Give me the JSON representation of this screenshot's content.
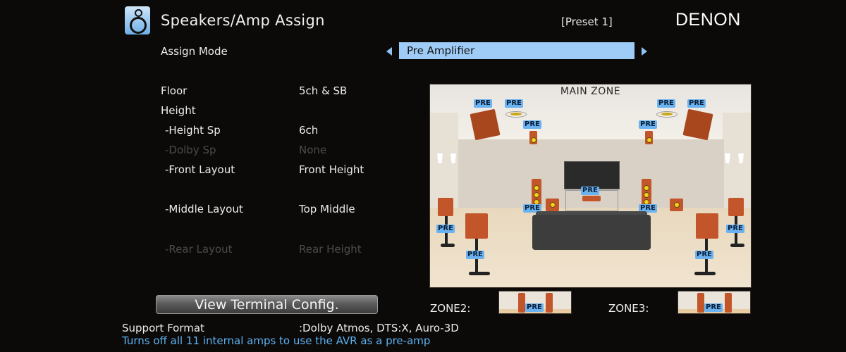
{
  "header": {
    "icon": "speaker-icon",
    "title": "Speakers/Amp Assign",
    "preset": "[Preset 1]",
    "brand": "DENON"
  },
  "assign_mode": {
    "label": "Assign Mode",
    "value": "Pre Amplifier",
    "left_arrow": "triangle-left-icon",
    "right_arrow": "triangle-right-icon",
    "accent_color": "#9fccf7"
  },
  "settings": [
    {
      "label": "Floor",
      "value": "5ch & SB",
      "enabled": true
    },
    {
      "label": "Height",
      "value": "",
      "enabled": true
    },
    {
      "label": "-Height Sp",
      "value": "6ch",
      "enabled": true
    },
    {
      "label": "-Dolby Sp",
      "value": "None",
      "enabled": false
    },
    {
      "label": "-Front Layout",
      "value": "Front Height",
      "enabled": true
    },
    {
      "label": "-Middle Layout",
      "value": "Top Middle",
      "enabled": true
    },
    {
      "label": "-Rear Layout",
      "value": "Rear Height",
      "enabled": false
    }
  ],
  "view_button": "View Terminal Config.",
  "support": {
    "label": "Support Format",
    "value": ":Dolby Atmos, DTS:X, Auro-3D"
  },
  "hint": "Turns off all 11 internal amps to use the AVR as a pre-amp",
  "hint_color": "#5bb2f2",
  "main_zone": {
    "title": "MAIN ZONE",
    "badge": "PRE",
    "badge_color": "#6bb3f0"
  },
  "zone2": {
    "label": "ZONE2:",
    "badge": "PRE"
  },
  "zone3": {
    "label": "ZONE3:",
    "badge": "PRE"
  }
}
